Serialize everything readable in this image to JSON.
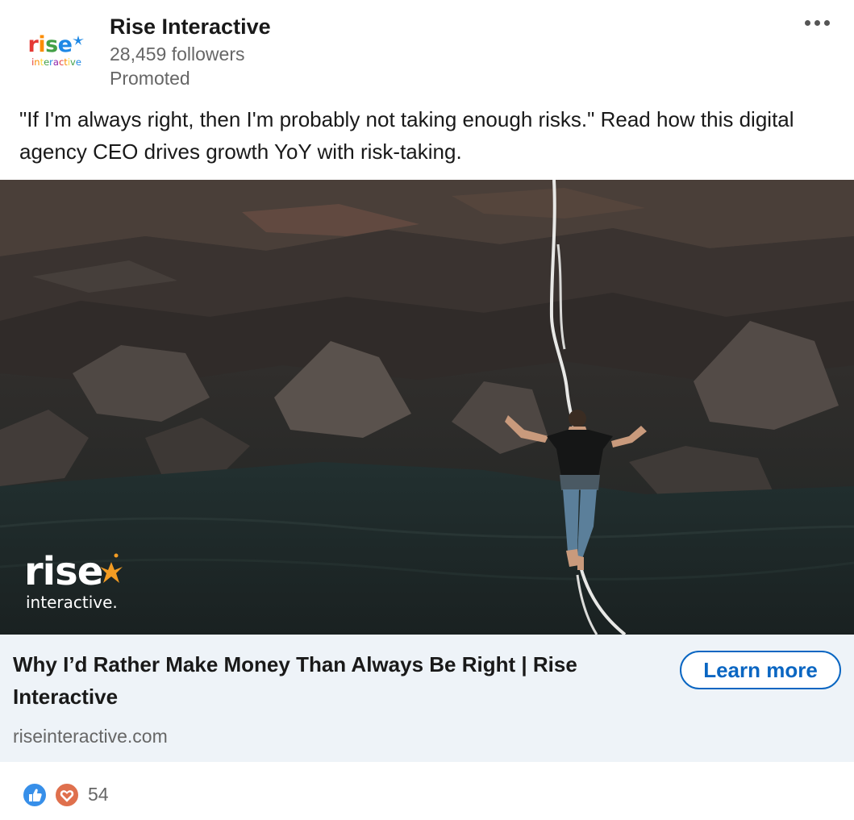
{
  "post": {
    "company_name": "Rise Interactive",
    "followers": "28,459 followers",
    "label": "Promoted",
    "logo": {
      "word": "rise",
      "sub": "interactive"
    },
    "more_icon": "ellipsis-icon",
    "commentary": "\"If I'm always right, then I'm probably not taking enough risks.\" Read how this digital agency CEO drives growth YoY with risk-taking."
  },
  "hero": {
    "overlay_logo": {
      "word": "rise",
      "sub": "interactive."
    }
  },
  "cta": {
    "title": "Why I’d Rather Make Money Than Always Be Right | Rise Interactive",
    "domain": "riseinteractive.com",
    "button_label": "Learn more",
    "button_color": "#0a66c2",
    "bar_color": "#eef3f8"
  },
  "social": {
    "reactions": [
      "like-icon",
      "love-icon"
    ],
    "count": "54"
  }
}
